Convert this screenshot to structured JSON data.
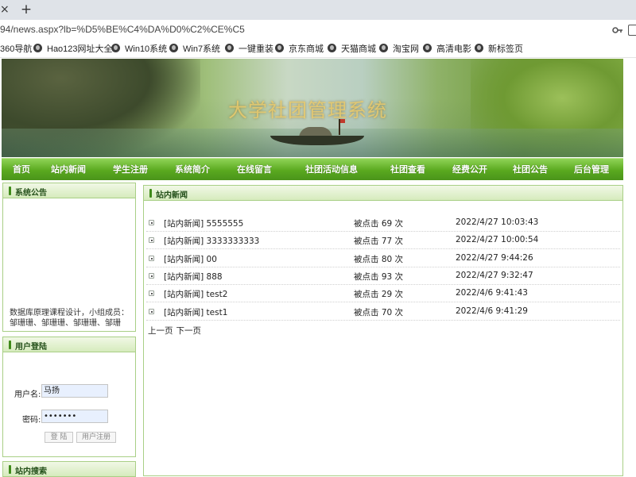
{
  "browser": {
    "tab_close": "×",
    "new_tab": "+",
    "url": "94/news.aspx?lb=%D5%BE%C4%DA%D0%C2%CE%C5",
    "bookmarks": [
      "360导航",
      "Hao123网址大全",
      "Win10系统",
      "Win7系统",
      "一键重装",
      "京东商城",
      "天猫商城",
      "淘宝网",
      "高清电影",
      "新标签页"
    ]
  },
  "site": {
    "banner_title": "大学社团管理系统",
    "nav": [
      "首页",
      "站内新闻",
      "学生注册",
      "系统简介",
      "在线留言",
      "社团活动信息",
      "社团查看",
      "经费公开",
      "社团公告",
      "后台管理"
    ]
  },
  "sidebar": {
    "notice_title": "系统公告",
    "notice_text": "数据库原理课程设计，小组成员：邹珊珊、邹珊珊、邹珊珊、邹珊",
    "login_title": "用户登陆",
    "username_label": "用户名:",
    "username_value": "马扬",
    "password_label": "密码:",
    "password_value": "•••••••",
    "login_button": "登 陆",
    "register_button": "用户注册",
    "search_title": "站内搜索"
  },
  "main": {
    "title": "站内新闻",
    "news": [
      {
        "title": "[站内新闻] 5555555",
        "hits": "被点击 69 次",
        "time": "2022/4/27 10:03:43"
      },
      {
        "title": "[站内新闻] 3333333333",
        "hits": "被点击 77 次",
        "time": "2022/4/27 10:00:54"
      },
      {
        "title": "[站内新闻] 00",
        "hits": "被点击 80 次",
        "time": "2022/4/27 9:44:26"
      },
      {
        "title": "[站内新闻] 888",
        "hits": "被点击 93 次",
        "time": "2022/4/27 9:32:47"
      },
      {
        "title": "[站内新闻] test2",
        "hits": "被点击 29 次",
        "time": "2022/4/6 9:41:43"
      },
      {
        "title": "[站内新闻] test1",
        "hits": "被点击 70 次",
        "time": "2022/4/6 9:41:29"
      }
    ],
    "prev_page": "上一页",
    "next_page": "下一页"
  },
  "colors": {
    "nav_green": "#5aa91f",
    "panel_border": "#a9cf86",
    "panel_title": "#24501a"
  }
}
